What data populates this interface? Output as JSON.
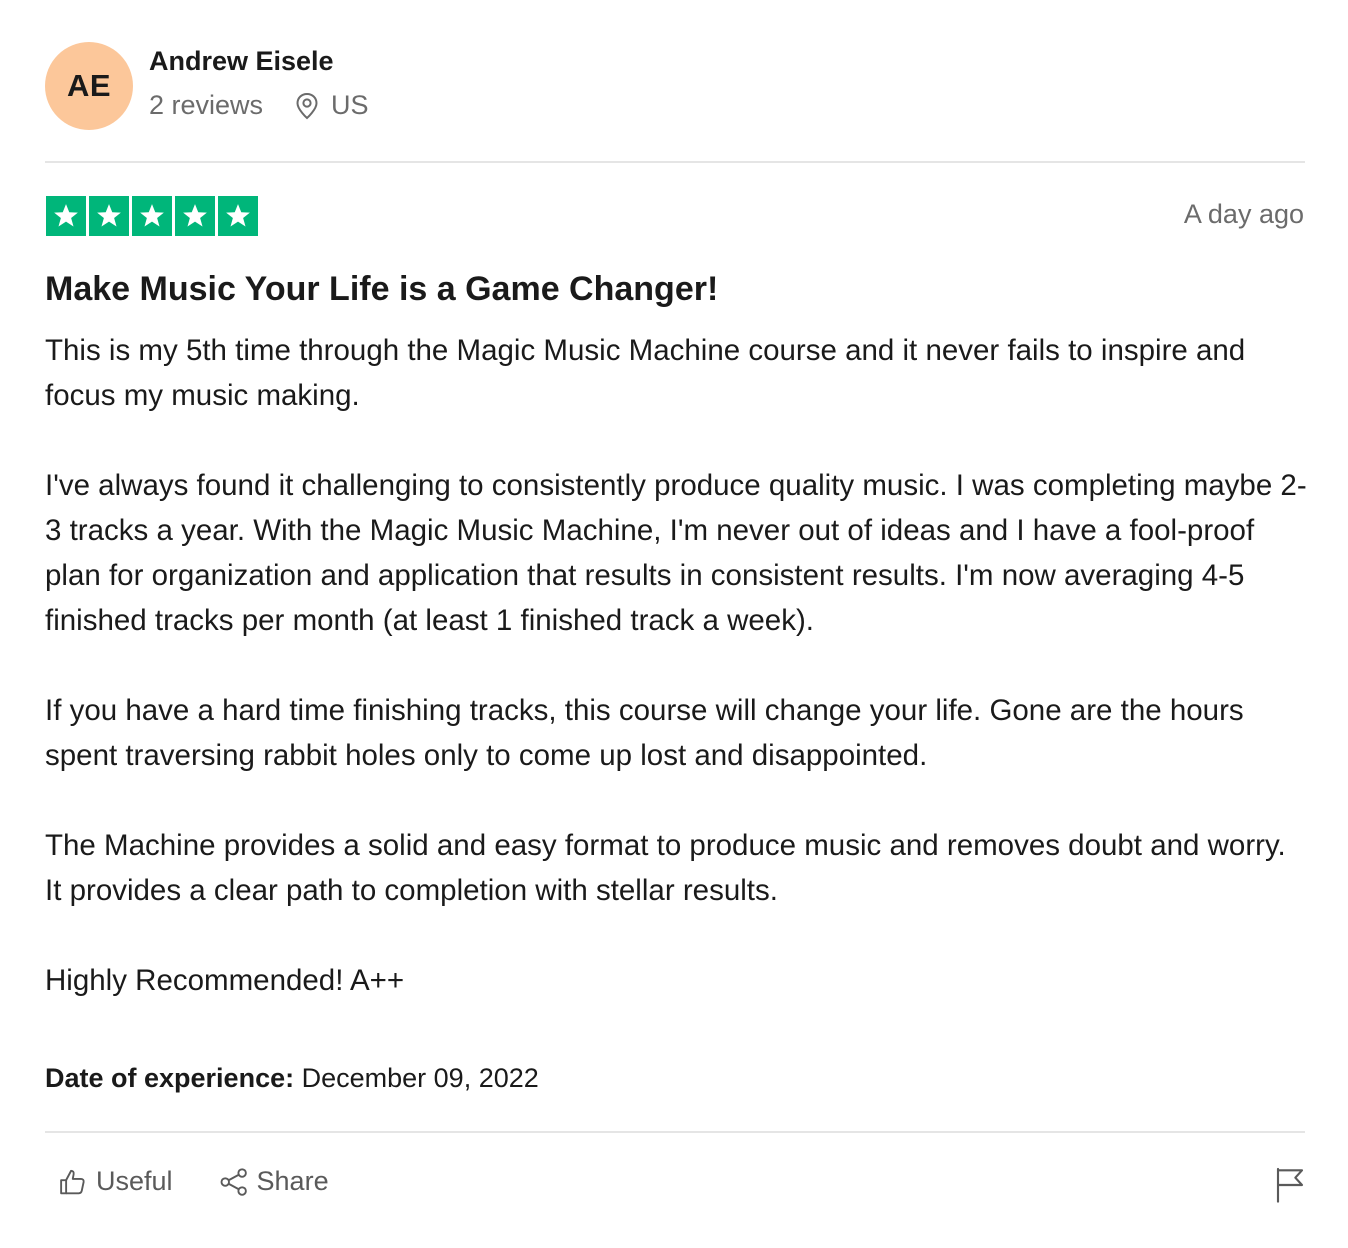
{
  "reviewer": {
    "initials": "AE",
    "name": "Andrew Eisele",
    "review_count": "2 reviews",
    "country": "US",
    "avatar_color": "#fcc79a"
  },
  "review": {
    "rating": 5,
    "star_color": "#00b67a",
    "posted": "A day ago",
    "title": "Make Music Your Life is a Game Changer!",
    "paragraphs": [
      "This is my 5th time through the Magic Music Machine course and it never fails to inspire and focus my music making.",
      "I've always found it challenging to consistently produce quality music. I was completing maybe 2-3 tracks a year. With the Magic Music Machine, I'm never out of ideas and I have a fool-proof plan for organization and application that results in consistent results. I'm now averaging 4-5 finished tracks per month (at least 1 finished track a week).",
      "If you have a hard time finishing tracks, this course will change your life. Gone are the hours spent traversing rabbit holes only to come up lost and disappointed.",
      "The Machine provides a solid and easy format to produce music and removes doubt and worry. It provides a clear path to completion with stellar results.",
      "Highly Recommended! A++"
    ],
    "experience_label": "Date of experience:",
    "experience_date": "December 09, 2022"
  },
  "actions": {
    "useful_label": "Useful",
    "share_label": "Share",
    "icons": [
      "thumbs-up-icon",
      "share-icon",
      "flag-icon",
      "location-pin-icon",
      "star-icon"
    ]
  }
}
